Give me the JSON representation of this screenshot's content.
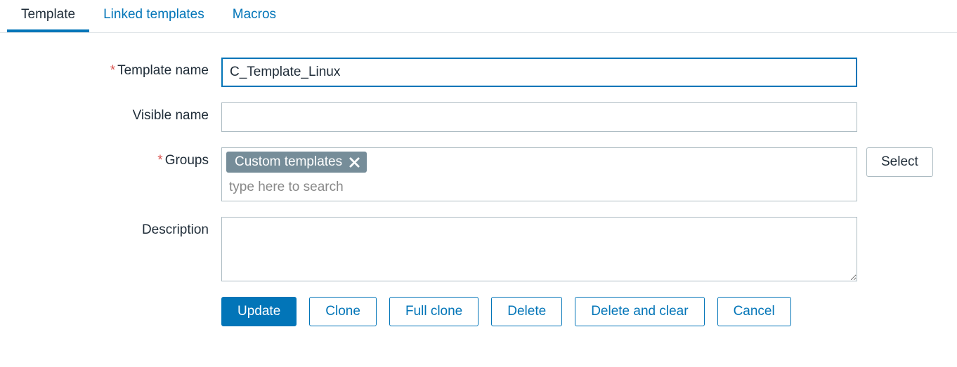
{
  "tabs": {
    "template": "Template",
    "linked_templates": "Linked templates",
    "macros": "Macros"
  },
  "labels": {
    "template_name": "Template name",
    "visible_name": "Visible name",
    "groups": "Groups",
    "description": "Description"
  },
  "fields": {
    "template_name_value": "C_Template_Linux",
    "visible_name_value": "",
    "groups_search_placeholder": "type here to search",
    "description_value": ""
  },
  "groups": {
    "tags": [
      {
        "label": "Custom templates"
      }
    ],
    "select_button": "Select"
  },
  "actions": {
    "update": "Update",
    "clone": "Clone",
    "full_clone": "Full clone",
    "delete": "Delete",
    "delete_and_clear": "Delete and clear",
    "cancel": "Cancel"
  }
}
